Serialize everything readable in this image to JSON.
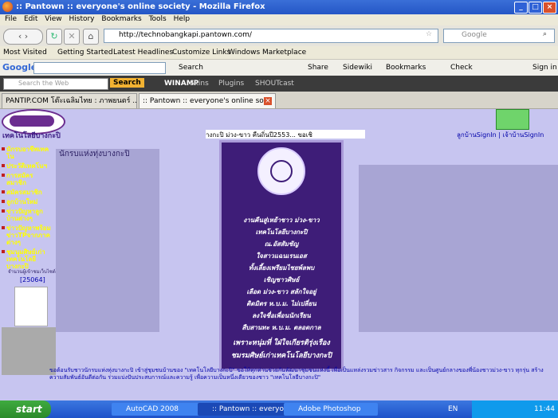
{
  "window": {
    "title": ":: Pantown :: everyone's online society - Mozilla Firefox"
  },
  "menu": [
    "File",
    "Edit",
    "View",
    "History",
    "Bookmarks",
    "Tools",
    "Help"
  ],
  "nav": {
    "url": "http://technobangkapi.pantown.com/",
    "search_placeholder": "Google"
  },
  "bookmarks": [
    "Most Visited",
    "Getting Started",
    "Latest Headlines",
    "Customize Links",
    "Windows Marketplace"
  ],
  "google_toolbar": {
    "logo": "Google",
    "search": "Search",
    "share": "Share",
    "sidewiki": "Sidewiki",
    "bookmarks": "Bookmarks",
    "check": "Check",
    "signin": "Sign in"
  },
  "winamp_toolbar": {
    "search_placeholder": "Search the Web",
    "search_btn": "Search",
    "winamp": "WINAMP",
    "skins": "Skins",
    "plugins": "Plugins",
    "shoutcast": "SHOUTcast"
  },
  "tabs": [
    {
      "label": "PANTIP.COM โต๊ะเฉลิมไทย : ภาพยนตร์ ..."
    },
    {
      "label": ":: Pantown :: everyone's online so..."
    }
  ],
  "page": {
    "logo_text": "เทคโนโลยีบางกะปิ",
    "ticker": "างกะปิ ม่วง-ขาว คืนถิ่นปี2553... ขอเชิ",
    "signin_links": "ลูกบ้านSignIn | เจ้าบ้านSignIn",
    "title": "นักรบแห่งทุ่งบางกะปิ",
    "sidebar": [
      "นักรบอาชีพเทคโน",
      "ประวัติเทคโนฯ",
      "การสมัครสมาชิก",
      "สมัครสมาชิก",
      "ลูกบ้านใหม่",
      "ข่าวปัญหาลูกบ้านต่างๆ",
      "ข่าวปัญหาพร้อมข่าวTPจากภาคต่างๆ",
      "ชุมนุมศิษย์เก่าเทคโนโลยีบางกะปิ"
    ],
    "counter_label": "จำนวนผู้เข้าชมเว็บไซต์",
    "counter": "[25064]",
    "card_lines": [
      "งานคืนสู่เหย้าชาว ม่วง-ขาว",
      "เทคโนโลยีบางกะปิ",
      "ณ.อัสสัมชัญ",
      "ใจสาวแฉนเรนเอส",
      "ทั้งเลี้ยงเพรียมไชยพ์ลพบ",
      "เชิญชาวศิษย์",
      "เลือด ม่วง-ขาว สลักใจอยู่",
      "ติดมิตร ห.บ.ม. ไม่เปลี่ยน",
      "ลงใจชื่อเพื่อนนักเรียน",
      "สืบสานทะ ห.บ.ม. ตลอดกาล",
      "เพราะหนุ่มที่ ใฝ่ใจเกียรติรุ่งเรือง",
      "ชมรมศิษย์เก่าเทคโนโลยีบางกะปิ"
    ],
    "bottom_text": "ขอต้อนรับชาวนักรบแห่งทุ่งบางกะปิ เข้าสู่ชุมชนบ้านของ \"เทคโนโลยีบางกะปิ\" ขอให้ทุกท่านช่วยกันพัฒนาชุมชนแห่งนี้ เพื่อเป็นแหล่งรวมข่าวสาร กิจกรรม และเป็นศูนย์กลางของพี่น้องชาวม่วง-ขาว ทุกรุ่น สร้างความสัมพันธ์อันดีต่อกัน ร่วมแบ่งปันประสบการณ์และความรู้ เพื่อความเป็นหนึ่งเดียวของชาว \"เทคโนโลยีบางกะปิ\""
  },
  "taskbar": {
    "start": "start",
    "tasks": [
      "AutoCAD 2008",
      ":: Pantown :: everyo...",
      "Adobe Photoshop"
    ],
    "lang": "EN",
    "time": "11:44"
  }
}
